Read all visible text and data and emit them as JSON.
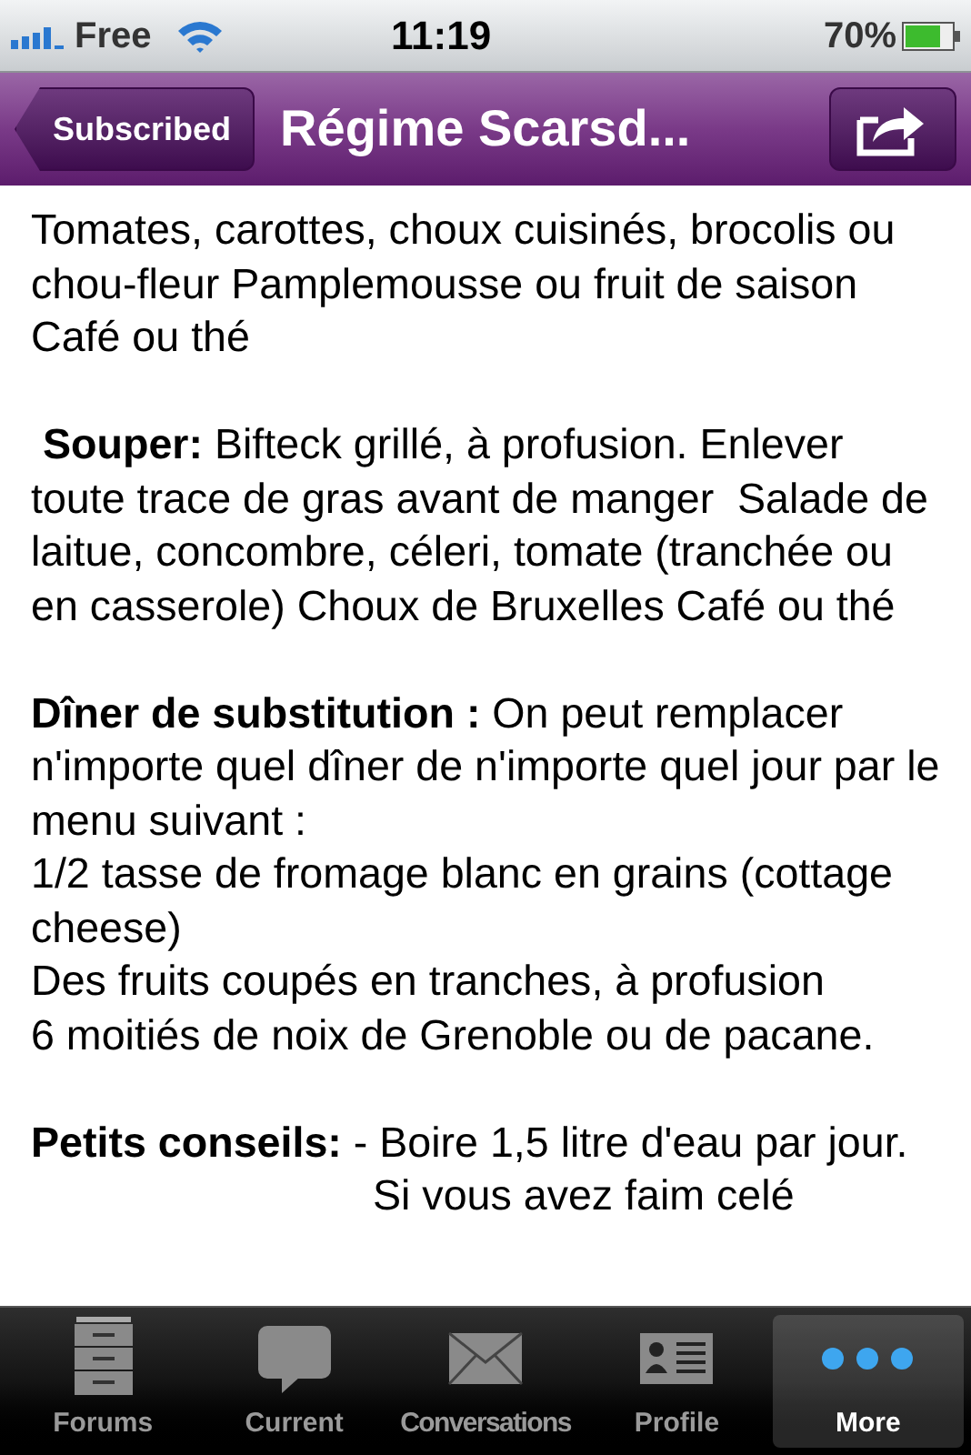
{
  "status_bar": {
    "carrier": "Free",
    "time": "11:19",
    "battery": "70%"
  },
  "nav_bar": {
    "back_button": "Subscribed",
    "title": "Régime Scarsd..."
  },
  "content": [
    {
      "kind": "paragraph",
      "text": "Tomates, carottes, choux cuisinés, brocolis ou chou-fleur Pamplemousse ou fruit de saison Café ou thé"
    },
    {
      "kind": "paragraph",
      "text": " **Souper:** Bifteck grillé, à profusion. Enlever toute trace de gras avant de manger  Salade de laitue, concombre, céleri, tomate (tranchée ou en casserole) Choux de Bruxelles Café ou thé"
    },
    {
      "kind": "paragraph",
      "text": "**Dîner de substitution :** On peut remplacer n'importe quel dîner de n'importe quel jour par le menu suivant :\n1/2 tasse de fromage blanc en grains (cottage cheese)\nDes fruits coupés en tranches, à profusion\n6 moitiés de noix de Grenoble ou de pacane."
    },
    {
      "kind": "paragraph",
      "text": "**Petits conseils:** - Boire 1,5 litre d'eau par jour."
    },
    {
      "kind": "indented_line",
      "text": "Si vous avez faim celé"
    }
  ],
  "tab_bar": [
    {
      "label": "Forums",
      "selected": false
    },
    {
      "label": "Current",
      "selected": false
    },
    {
      "label": "Conversations",
      "selected": false
    },
    {
      "label": "Profile",
      "selected": false
    },
    {
      "label": "More",
      "selected": true
    }
  ]
}
